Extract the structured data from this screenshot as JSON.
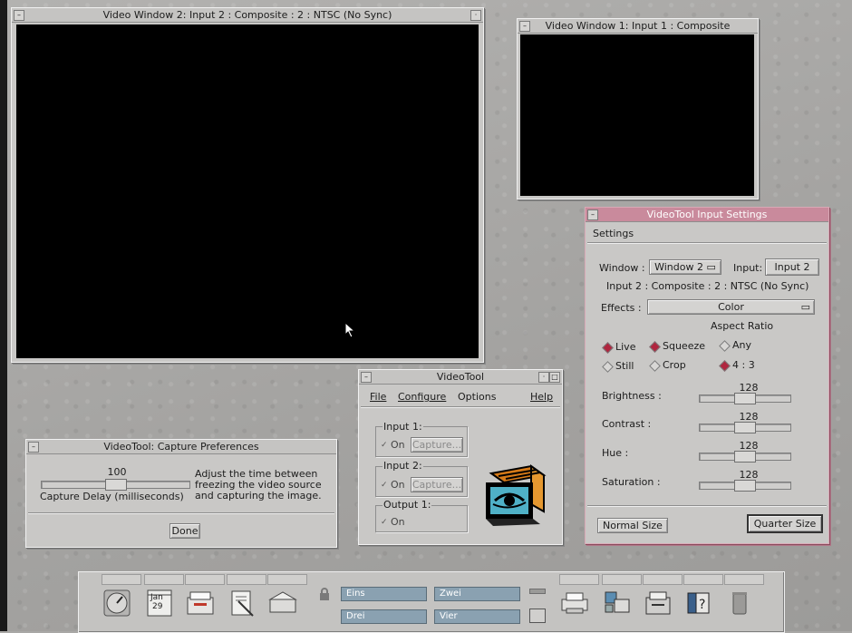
{
  "video_window_2": {
    "title": "Video Window 2: Input 2 : Composite : 2 : NTSC (No Sync)"
  },
  "video_window_1": {
    "title": "Video Window 1: Input 1 : Composite"
  },
  "input_settings": {
    "title": "VideoTool Input Settings",
    "menu_settings": "Settings",
    "window_label": "Window :",
    "window_value": "Window 2",
    "input_label": "Input:",
    "input_value": "Input 2",
    "source_info": "Input 2 : Composite : 2 : NTSC (No Sync)",
    "effects_label": "Effects :",
    "effects_value": "Color",
    "aspect_ratio_label": "Aspect Ratio",
    "radio_live": "Live",
    "radio_still": "Still",
    "radio_squeeze": "Squeeze",
    "radio_crop": "Crop",
    "radio_any": "Any",
    "radio_4_3": "4 : 3",
    "brightness_label": "Brightness :",
    "brightness_value": "128",
    "contrast_label": "Contrast :",
    "contrast_value": "128",
    "hue_label": "Hue :",
    "hue_value": "128",
    "saturation_label": "Saturation :",
    "saturation_value": "128",
    "normal_size": "Normal Size",
    "quarter_size": "Quarter Size"
  },
  "videotool": {
    "title": "VideoTool",
    "menu_file": "File",
    "menu_configure": "Configure",
    "menu_options": "Options",
    "menu_help": "Help",
    "input1_label": "Input 1:",
    "input2_label": "Input 2:",
    "output1_label": "Output 1:",
    "on_label": "On",
    "capture_label": "Capture..."
  },
  "capture_prefs": {
    "title": "VideoTool: Capture Preferences",
    "delay_value": "100",
    "delay_label": "Capture Delay (milliseconds)",
    "help_line1": "Adjust the time between",
    "help_line2": "freezing the video source",
    "help_line3": "and capturing the image.",
    "done": "Done"
  },
  "dock": {
    "calendar_month": "Jan",
    "calendar_day": "29",
    "workspace_1": "Eins",
    "workspace_2": "Zwei",
    "workspace_3": "Drei",
    "workspace_4": "Vier"
  },
  "colors": {
    "accent_pink": "#c98a9c",
    "workspace_blue": "#8aa1b1",
    "radio_selected": "#b0263f"
  }
}
